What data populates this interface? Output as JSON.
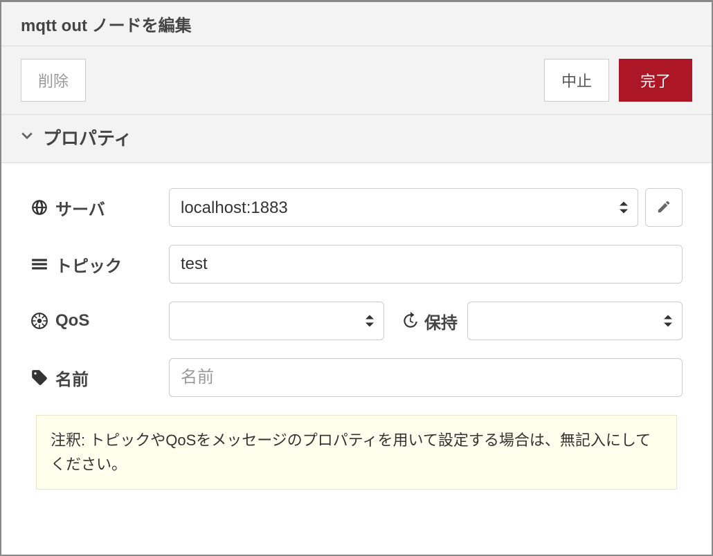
{
  "header": {
    "title": "mqtt out ノードを編集"
  },
  "toolbar": {
    "delete": "削除",
    "cancel": "中止",
    "done": "完了"
  },
  "section": {
    "title": "プロパティ"
  },
  "fields": {
    "server": {
      "label": "サーバ",
      "value": "localhost:1883"
    },
    "topic": {
      "label": "トピック",
      "value": "test"
    },
    "qos": {
      "label": "QoS",
      "value": ""
    },
    "retain": {
      "label": "保持",
      "value": ""
    },
    "name": {
      "label": "名前",
      "placeholder": "名前",
      "value": ""
    }
  },
  "note": "注釈: トピックやQoSをメッセージのプロパティを用いて設定する場合は、無記入にしてください。"
}
